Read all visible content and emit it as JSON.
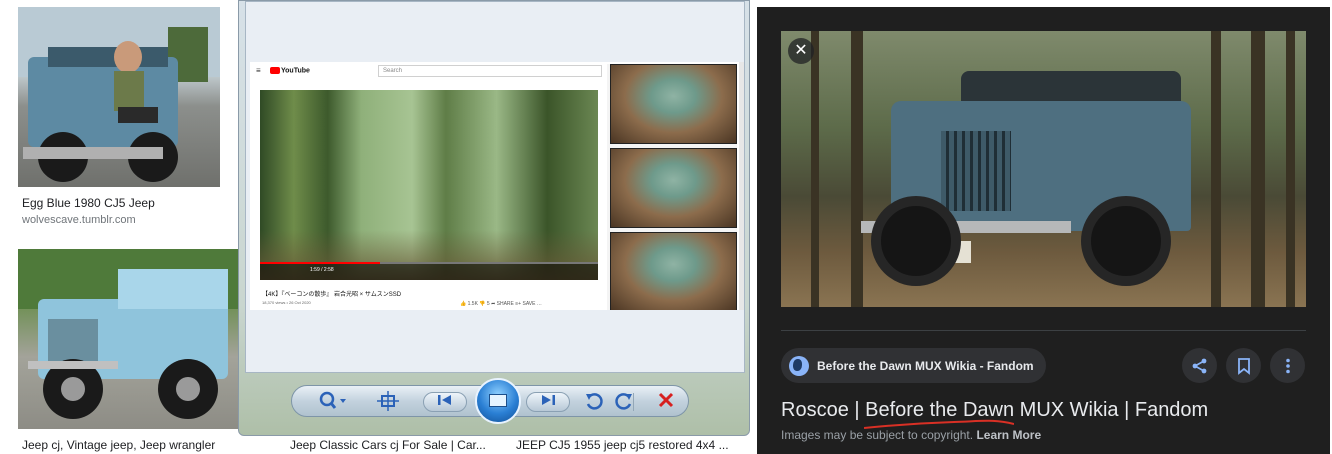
{
  "grid": {
    "item1": {
      "title": "Egg Blue 1980 CJ5 Jeep",
      "site": "wolvescave.tumblr.com"
    },
    "item2": {
      "title": "Jeep cj, Vintage jeep, Jeep wrangler"
    },
    "item3": {
      "title": "Jeep Classic Cars cj For Sale | Car..."
    },
    "item4": {
      "title": "JEEP CJ5 1955 jeep cj5 restored 4x4 ..."
    }
  },
  "viewer": {
    "youtube": {
      "logo": "YouTube",
      "search_placeholder": "Search",
      "time": "1:59 / 2:58",
      "video_title": "【4K】『ベーコンの散歩』 岩合光昭 × サムスンSSD",
      "meta": "18,370 views • 26 Oct 2020",
      "actions": "👍 1.5K   👎 5   ➦ SHARE   ≡+ SAVE   …"
    },
    "toolbar": {
      "zoom_icon": "magnifier-icon",
      "actual_size_icon": "actual-size-icon",
      "prev_icon": "previous-icon",
      "slideshow_icon": "slideshow-icon",
      "next_icon": "next-icon",
      "rotate_ccw_icon": "rotate-counterclockwise-icon",
      "rotate_cw_icon": "rotate-clockwise-icon",
      "delete_icon": "delete-icon"
    }
  },
  "panel": {
    "source": "Before the Dawn MUX Wikia - Fandom",
    "title": "Roscoe | Before the Dawn MUX Wikia | Fandom",
    "copyright": "Images may be subject to copyright.",
    "learn_more": "Learn More",
    "colors": {
      "background": "#1f1f1f",
      "chip": "#303134",
      "accent": "#8ab4f8",
      "annotation": "#d93025"
    }
  }
}
